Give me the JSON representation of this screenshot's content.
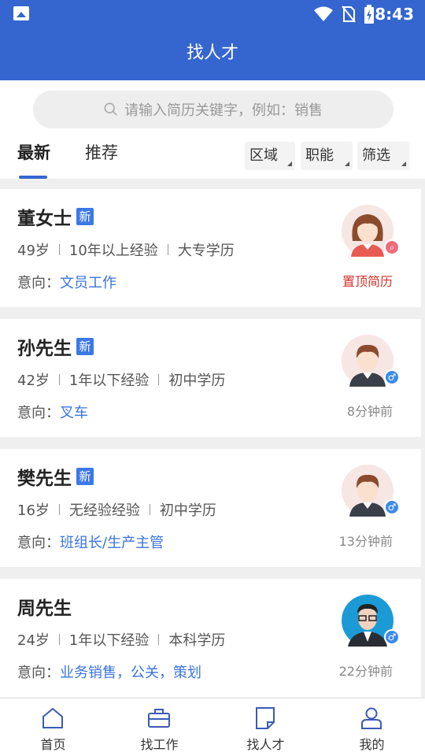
{
  "status": {
    "time": "8:43"
  },
  "header": {
    "title": "找人才"
  },
  "search": {
    "placeholder": "请输入简历关键字，例如：销售"
  },
  "tabs": [
    {
      "label": "最新"
    },
    {
      "label": "推荐"
    }
  ],
  "filters": [
    {
      "label": "区域"
    },
    {
      "label": "职能"
    },
    {
      "label": "筛选"
    }
  ],
  "intent_label": "意向：",
  "badge_new": "新",
  "resumes": [
    {
      "name": "董女士",
      "is_new": true,
      "age": "49岁",
      "experience": "10年以上经验",
      "education": "大专学历",
      "intent": "文员工作",
      "meta": "置顶简历",
      "gender_icon": "search-badge-icon",
      "avatar": "female-avatar"
    },
    {
      "name": "孙先生",
      "is_new": true,
      "age": "42岁",
      "experience": "1年以下经验",
      "education": "初中学历",
      "intent": "叉车",
      "meta": "8分钟前",
      "gender_icon": "male-icon",
      "avatar": "male-avatar"
    },
    {
      "name": "樊先生",
      "is_new": true,
      "age": "16岁",
      "experience": "无经验经验",
      "education": "初中学历",
      "intent": "班组长/生产主管",
      "meta": "13分钟前",
      "gender_icon": "male-icon",
      "avatar": "male-avatar"
    },
    {
      "name": "周先生",
      "is_new": false,
      "age": "24岁",
      "experience": "1年以下经验",
      "education": "本科学历",
      "intent": "业务销售，公关，策划",
      "meta": "22分钟前",
      "gender_icon": "male-icon",
      "avatar": "photo-avatar"
    }
  ],
  "bottom_nav": [
    {
      "label": "首页",
      "icon": "home-icon"
    },
    {
      "label": "找工作",
      "icon": "briefcase-icon"
    },
    {
      "label": "找人才",
      "icon": "resume-icon"
    },
    {
      "label": "我的",
      "icon": "profile-icon"
    }
  ],
  "colors": {
    "primary": "#3566cf",
    "link": "#3a74de",
    "top_resume": "#d0342c",
    "new_badge": "#3c78e6"
  }
}
